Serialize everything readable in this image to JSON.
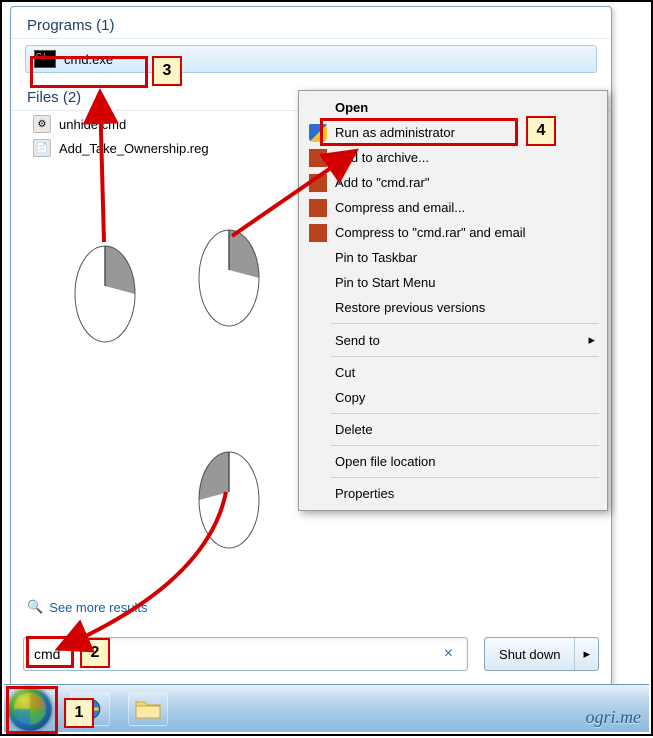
{
  "headers": {
    "programs": "Programs (1)",
    "files": "Files (2)"
  },
  "programs": [
    {
      "label": "cmd.exe"
    }
  ],
  "files": [
    {
      "label": "unhide.cmd"
    },
    {
      "label": "Add_Take_Ownership.reg"
    }
  ],
  "see_more": "See more results",
  "search": {
    "value": "cmd",
    "clear": "×"
  },
  "shutdown": {
    "label": "Shut down",
    "arrow": "▸"
  },
  "context_menu": {
    "open": "Open",
    "run_admin": "Run as administrator",
    "add_archive": "Add to archive...",
    "add_cmd_rar": "Add to \"cmd.rar\"",
    "compress_email": "Compress and email...",
    "compress_cmd_email": "Compress to \"cmd.rar\" and email",
    "pin_taskbar": "Pin to Taskbar",
    "pin_start": "Pin to Start Menu",
    "restore_prev": "Restore previous versions",
    "send_to": "Send to",
    "cut": "Cut",
    "copy": "Copy",
    "delete": "Delete",
    "open_loc": "Open file location",
    "properties": "Properties",
    "submenu_arrow": "▸"
  },
  "annotations": {
    "n1": "1",
    "n2": "2",
    "n3": "3",
    "n4": "4"
  },
  "watermark": "ogri.me"
}
